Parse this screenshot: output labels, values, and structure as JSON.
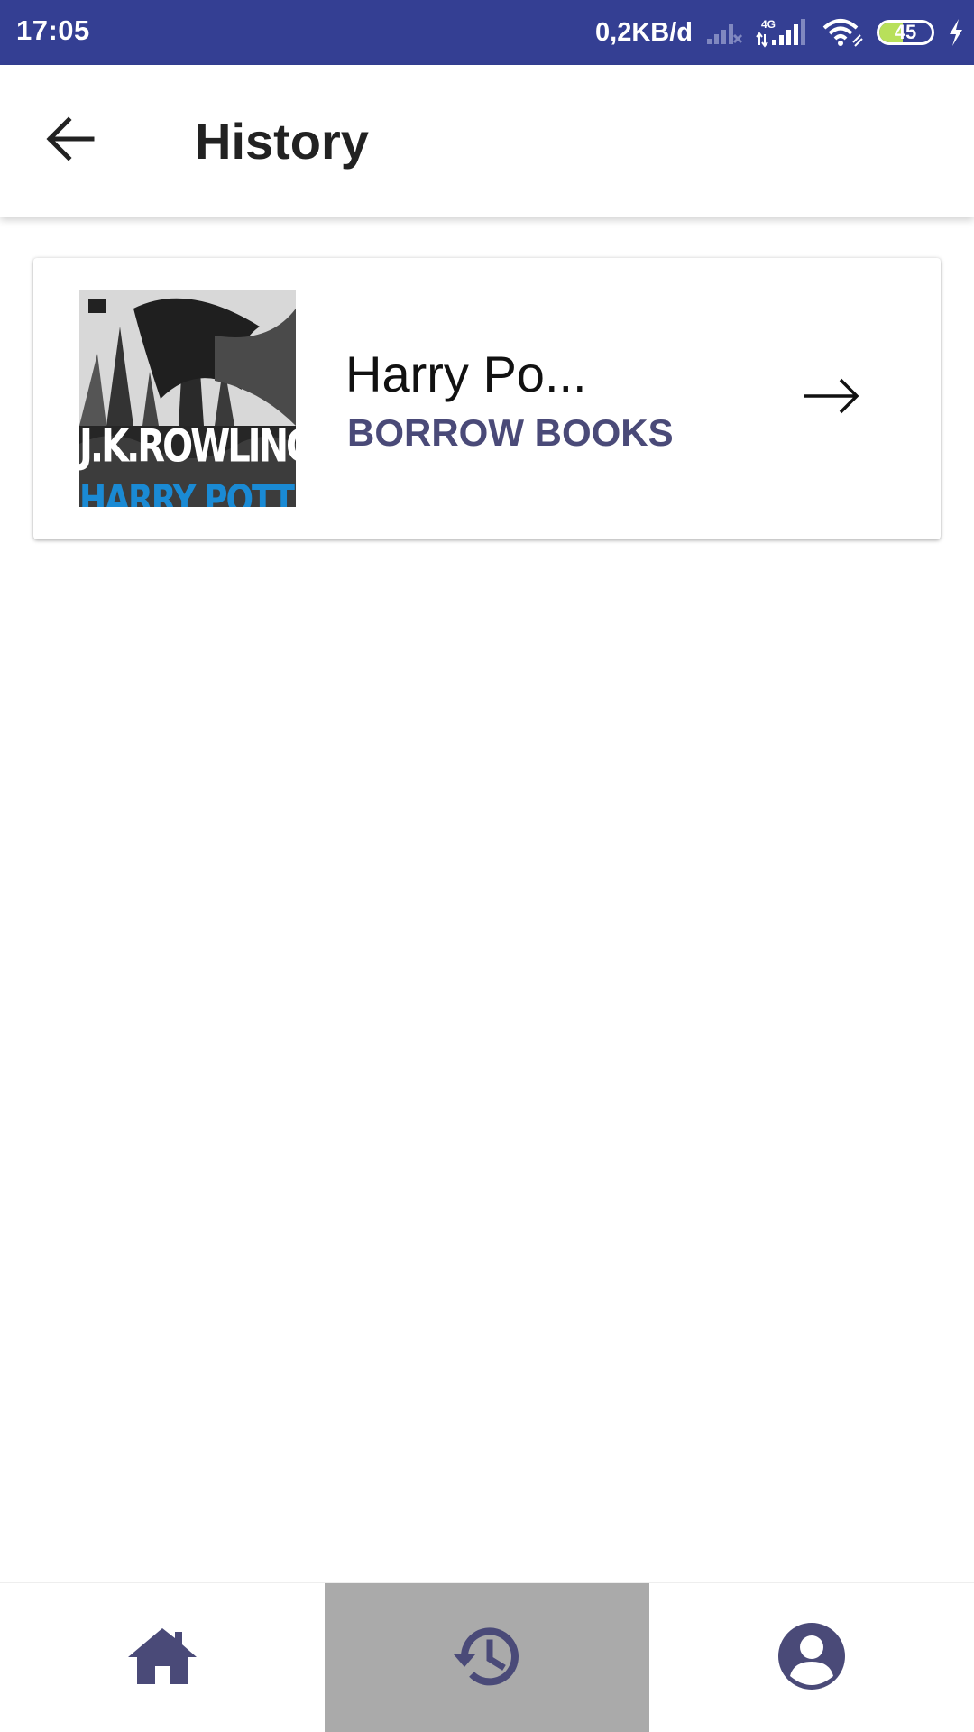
{
  "status_bar": {
    "time": "17:05",
    "data_speed": "0,2KB/d",
    "network_type": "4G",
    "battery_level": "45",
    "battery_fraction": 0.45,
    "icons": [
      "signal-no-service-icon",
      "signal-4g-icon",
      "wifi-icon",
      "battery-icon",
      "charging-icon"
    ],
    "background_color": "#343f93"
  },
  "app_bar": {
    "title": "History",
    "back_icon": "arrow-left-icon"
  },
  "history": {
    "items": [
      {
        "title": "Harry Po...",
        "status": "BORROW BOOKS",
        "cover_author": "J.K.ROWLING",
        "cover_series": "HARRY POTTER",
        "action_icon": "arrow-right-icon"
      }
    ]
  },
  "bottom_nav": {
    "items": [
      {
        "icon": "home-icon",
        "active": false
      },
      {
        "icon": "history-icon",
        "active": true
      },
      {
        "icon": "account-icon",
        "active": false
      }
    ],
    "icon_color": "#4a4a78",
    "active_background": "#aaaaaa"
  }
}
